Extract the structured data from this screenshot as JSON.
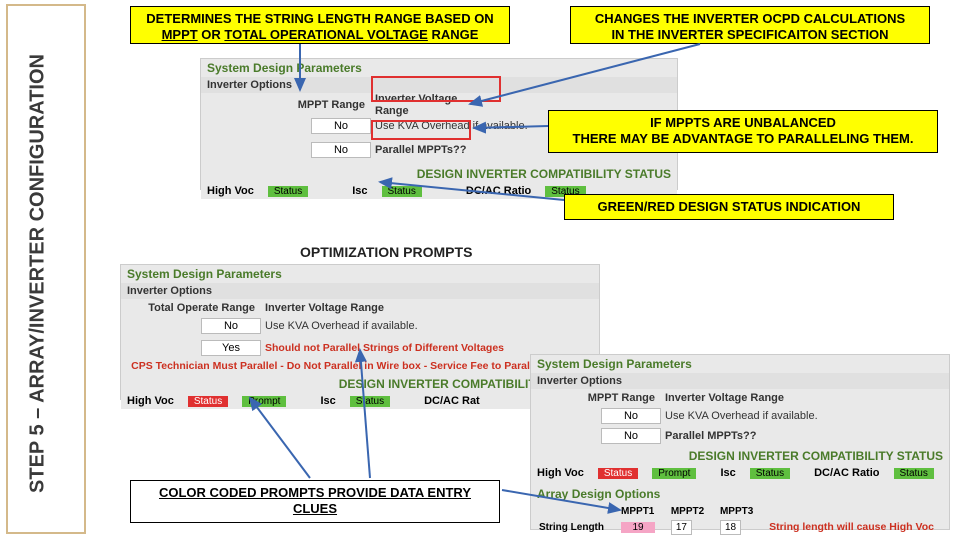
{
  "sidebar": {
    "title": "STEP  5 – ARRAY/INVERTER CONFIGURATION"
  },
  "callouts": {
    "top_left_a": "DETERMINES THE STRING LENGTH RANGE BASED ON",
    "top_left_b1": "MPPT",
    "top_left_b2": " OR ",
    "top_left_b3": "TOTAL OPERATIONAL VOLTAGE",
    "top_left_b4": " RANGE",
    "top_right_a": "CHANGES THE INVERTER OCPD CALCULATIONS",
    "top_right_b": "IN THE INVERTER SPECIFICAITON SECTION",
    "mppt_unbal_a": "IF MPPTS ARE UNBALANCED",
    "mppt_unbal_b": "THERE MAY BE ADVANTAGE TO PARALLELING THEM.",
    "green_red": "GREEN/RED DESIGN STATUS INDICATION",
    "opt_prompts": "OPTIMIZATION PROMPTS",
    "color_coded": "COLOR CODED PROMPTS PROVIDE DATA ENTRY CLUES"
  },
  "panel1": {
    "title": "System Design Parameters",
    "sub": "Inverter Options",
    "r1_label": "MPPT Range",
    "r1_val": "No",
    "r1_text": "Inverter Voltage Range",
    "r2_text": "Use KVA Overhead if available.",
    "r3_val": "No",
    "r3_text": "Parallel MPPTs??",
    "status_title": "DESIGN INVERTER COMPATIBILITY STATUS",
    "hv": "High Voc",
    "hv_status": "Status",
    "isc": "Isc",
    "isc_status": "Status",
    "dcac": "DC/AC Ratio",
    "dcac_status": "Status"
  },
  "panel2": {
    "title": "System Design Parameters",
    "sub": "Inverter Options",
    "r1_label": "Total Operate Range",
    "r1_val": "No",
    "r1_text": "Inverter Voltage Range",
    "r2_text": "Use KVA Overhead if available.",
    "r3_val": "Yes",
    "r3_text": "Should not Parallel Strings of Different Voltages",
    "warn": "CPS Technician Must Parallel - Do Not Parallel in Wire box - Service Fee to Parallel Inverters",
    "status_title": "DESIGN INVERTER COMPATIBILITY STATUS",
    "hv": "High Voc",
    "hv_status": "Status",
    "hv_prompt": "Prompt",
    "isc": "Isc",
    "isc_status": "Status",
    "dcac": "DC/AC Rat"
  },
  "panel3": {
    "title": "System Design Parameters",
    "sub": "Inverter Options",
    "r1_label": "MPPT Range",
    "r1_val": "No",
    "r1_text": "Inverter Voltage Range",
    "r2_text": "Use KVA Overhead if available.",
    "r3_val": "No",
    "r3_text": "Parallel MPPTs??",
    "status_title": "DESIGN INVERTER COMPATIBILITY STATUS",
    "hv": "High Voc",
    "hv_status": "Status",
    "hv_prompt": "Prompt",
    "isc": "Isc",
    "isc_status": "Status",
    "dcac": "DC/AC Ratio",
    "dcac_status": "Status",
    "array_title": "Array Design Options",
    "sl_label": "String Length",
    "m1": "MPPT1",
    "m2": "MPPT2",
    "m3": "MPPT3",
    "v1": "19",
    "v2": "17",
    "v3": "18",
    "sl_warn": "String length will cause High Voc"
  }
}
